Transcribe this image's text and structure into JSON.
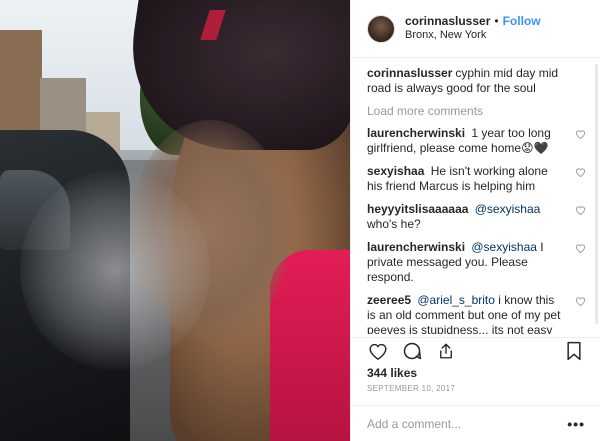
{
  "header": {
    "username": "corinnaslusser",
    "separator": "•",
    "follow_label": "Follow",
    "location": "Bronx, New York"
  },
  "caption": {
    "username": "corinnaslusser",
    "text": "cyphin mid day mid road is always good for the soul"
  },
  "load_more_label": "Load more comments",
  "comments": [
    {
      "username": "laurencherwinski",
      "mention": "",
      "text": "1 year too long girlfriend, please come home😟🖤"
    },
    {
      "username": "sexyishaa",
      "mention": "",
      "text": "He isn't working alone his friend Marcus is helping him"
    },
    {
      "username": "heyyyitslisaaaaaa",
      "mention": "@sexyishaa",
      "text": "who's he?"
    },
    {
      "username": "laurencherwinski",
      "mention": "@sexyishaa",
      "text": "I private messaged you. Please respond."
    },
    {
      "username": "zeeree5",
      "mention": "@ariel_s_brito",
      "text": "i know this is an old comment but one of my pet peeves is stupidness... its not easy for some of them to just get away while they are alone with you lol life youre a savior hero?! And ypu just paid to have sex with them like theyre gonna trust you?!"
    }
  ],
  "icons": {
    "like": "heart-icon",
    "comment": "comment-icon",
    "share": "share-icon",
    "save": "bookmark-icon",
    "more": "more-options-icon"
  },
  "likes_label": "344 likes",
  "date": "SEPTEMBER 10, 2017",
  "add_comment": {
    "placeholder": "Add a comment...",
    "more_label": "•••"
  },
  "colors": {
    "link": "#3897f0",
    "mention": "#003569",
    "muted": "#999999",
    "text": "#262626"
  }
}
